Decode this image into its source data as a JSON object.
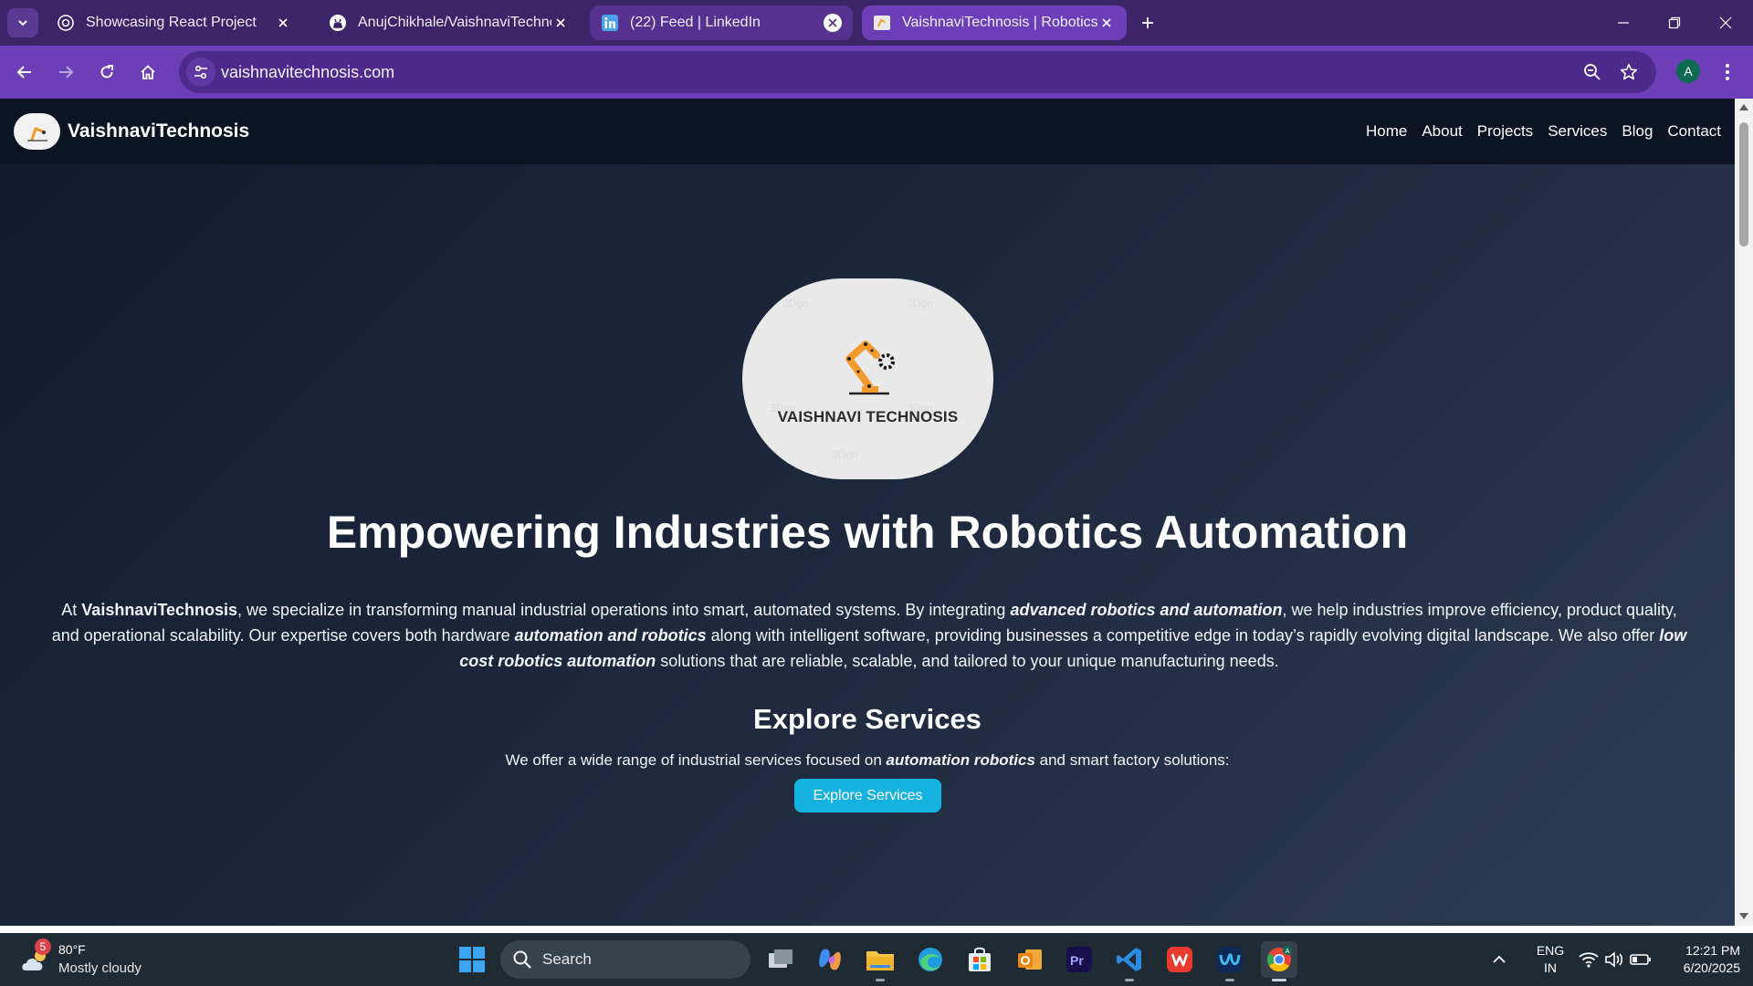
{
  "browser": {
    "tabs": [
      {
        "title": "Showcasing React Project",
        "icon": "openai-icon"
      },
      {
        "title": "AnujChikhale/VaishnaviTechnosis",
        "icon": "github-icon"
      },
      {
        "title": "(22) Feed | LinkedIn",
        "icon": "linkedin-icon"
      },
      {
        "title": "VaishnaviTechnosis | Robotics Automation",
        "icon": "site-favicon"
      }
    ],
    "active_tab_index": 3,
    "url": "vaishnavitechnosis.com",
    "profile_initial": "A"
  },
  "site": {
    "brand": "VaishnaviTechnosis",
    "nav": [
      "Home",
      "About",
      "Projects",
      "Services",
      "Blog",
      "Contact"
    ],
    "hero_logo_text": "VAISHNAVI TECHNOSIS",
    "hero_title": "Empowering Industries with Robotics Automation",
    "intro": {
      "p1": "At ",
      "b1": "VaishnaviTechnosis",
      "p2": ", we specialize in transforming manual industrial operations into smart, automated systems. By integrating ",
      "bi1": "advanced robotics and automation",
      "p3": ", we help industries improve efficiency, product quality, and operational scalability. Our expertise covers both hardware ",
      "bi2": "automation and robotics",
      "p4": " along with intelligent software, providing businesses a competitive edge in today’s rapidly evolving digital landscape. We also offer ",
      "bi3": "low cost robotics automation",
      "p5": " solutions that are reliable, scalable, and tailored to your unique manufacturing needs."
    },
    "services_title": "Explore Services",
    "services_sub": {
      "p1": "We offer a wide range of industrial services focused on ",
      "bi": "automation robotics",
      "p2": " and smart factory solutions:"
    },
    "cta_label": "Explore Services"
  },
  "taskbar": {
    "weather_badge": "5",
    "temp": "80°F",
    "condition": "Mostly cloudy",
    "search_label": "Search",
    "lang_line1": "ENG",
    "lang_line2": "IN",
    "time": "12:21 PM",
    "date": "6/20/2025"
  },
  "colors": {
    "tabbar": "#3b2467",
    "toolbar": "#6c3fb8",
    "page_bg": "#1e2638",
    "cta": "#15b2e0",
    "taskbar": "#202a33"
  }
}
